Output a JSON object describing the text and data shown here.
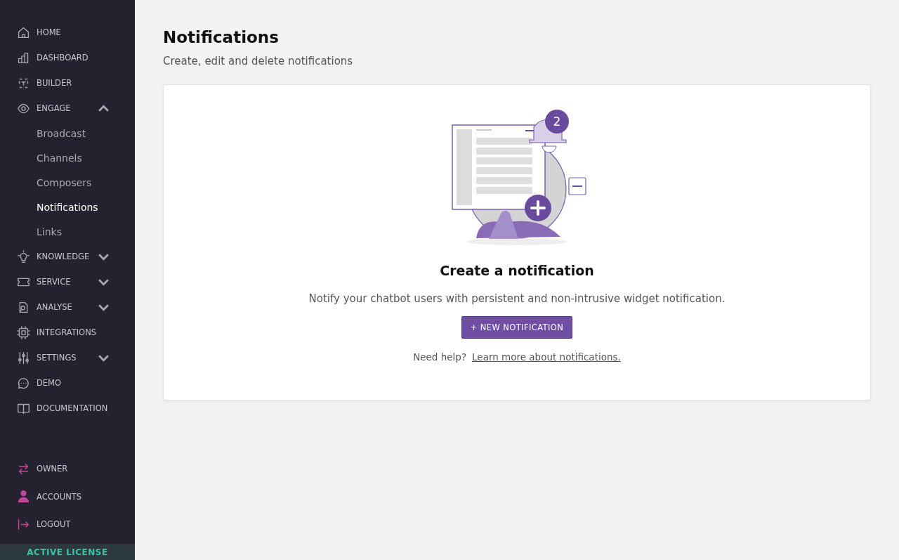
{
  "sidebar": {
    "items": [
      {
        "kind": "link",
        "label": "HOME"
      },
      {
        "kind": "link",
        "label": "DASHBOARD"
      },
      {
        "kind": "link",
        "label": "BUILDER"
      },
      {
        "kind": "group",
        "label": "ENGAGE",
        "expanded": true,
        "children": [
          {
            "label": "Broadcast",
            "selected": false
          },
          {
            "label": "Channels",
            "selected": false
          },
          {
            "label": "Composers",
            "selected": false
          },
          {
            "label": "Notifications",
            "selected": true
          },
          {
            "label": "Links",
            "selected": false
          }
        ]
      },
      {
        "kind": "group",
        "label": "KNOWLEDGE",
        "expanded": false
      },
      {
        "kind": "group",
        "label": "SERVICE",
        "expanded": false
      },
      {
        "kind": "group",
        "label": "ANALYSE",
        "expanded": false
      },
      {
        "kind": "link",
        "label": "INTEGRATIONS"
      },
      {
        "kind": "group",
        "label": "SETTINGS",
        "expanded": false
      },
      {
        "kind": "link",
        "label": "DEMO"
      },
      {
        "kind": "link",
        "label": "DOCUMENTATION"
      }
    ],
    "bottom_items": [
      "OWNER",
      "ACCOUNTS",
      "LOGOUT"
    ],
    "license": "ACTIVE LICENSE"
  },
  "page": {
    "title": "Notifications",
    "subtitle": "Create, edit and delete notifications"
  },
  "empty_state": {
    "badge": "2",
    "heading": "Create a notification",
    "description": "Notify your chatbot users with persistent and non-intrusive widget notification.",
    "button": "+ NEW NOTIFICATION",
    "help": "Need help?",
    "link": "Learn more about notifications."
  }
}
